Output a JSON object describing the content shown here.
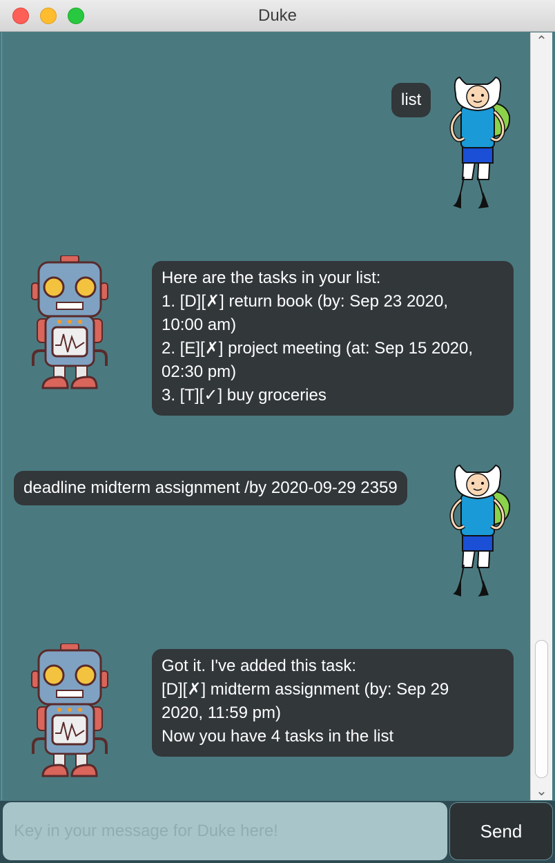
{
  "window": {
    "title": "Duke"
  },
  "messages": [
    {
      "from": "user",
      "lines": [
        "list"
      ]
    },
    {
      "from": "duke",
      "lines": [
        "Here are the tasks in your list:",
        "1. [D][✗] return book (by: Sep 23 2020,",
        "10:00 am)",
        "2. [E][✗] project meeting (at: Sep 15 2020,",
        "02:30 pm)",
        "3. [T][✓] buy groceries"
      ]
    },
    {
      "from": "user",
      "lines": [
        "deadline midterm assignment /by 2020-09-29 2359"
      ]
    },
    {
      "from": "duke",
      "lines": [
        "Got it. I've added this task:",
        "[D][✗] midterm assignment (by: Sep 29",
        "2020, 11:59 pm)",
        "Now you have 4 tasks in the list"
      ]
    }
  ],
  "avatars": {
    "user": "finn-avatar",
    "duke": "robot-avatar"
  },
  "input": {
    "placeholder": "Key in your message for Duke here!",
    "value": ""
  },
  "send_button": {
    "label": "Send"
  },
  "icons": {
    "scroll_up": "chevron-up-icon",
    "scroll_down": "chevron-down-icon"
  },
  "colors": {
    "background": "#4a7a80",
    "bubble": "#32373a",
    "input": "#a8c6ca",
    "button": "#2c3134"
  }
}
